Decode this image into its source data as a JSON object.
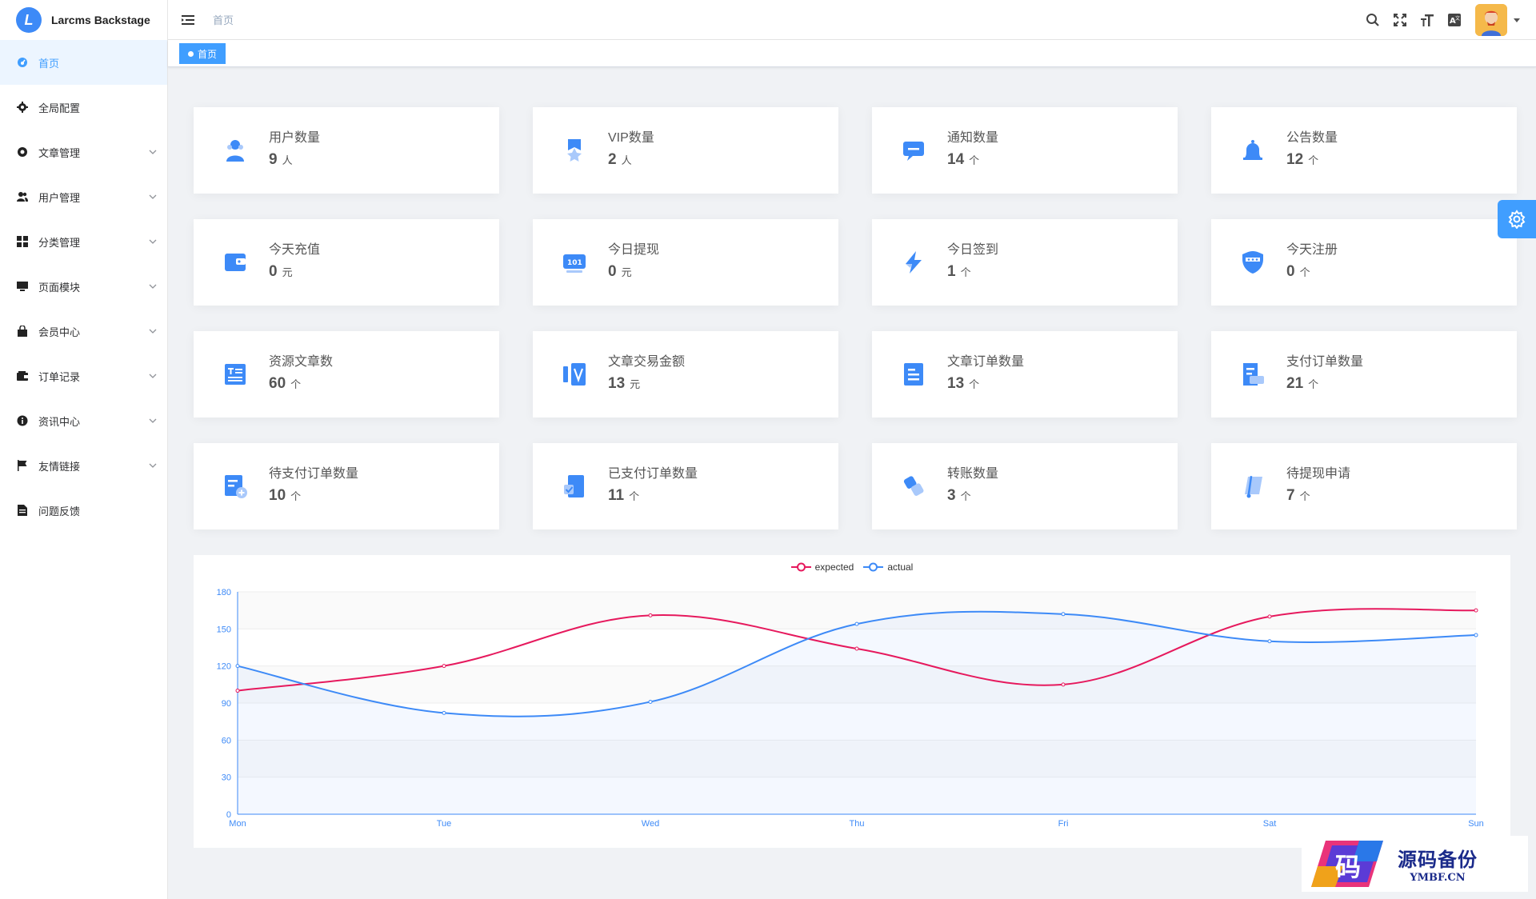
{
  "app": {
    "title": "Larcms Backstage",
    "logo_letter": "L"
  },
  "sidebar": {
    "items": [
      {
        "label": "首页",
        "icon": "dashboard-icon",
        "active": true,
        "has_children": false
      },
      {
        "label": "全局配置",
        "icon": "gear-icon",
        "active": false,
        "has_children": false
      },
      {
        "label": "文章管理",
        "icon": "lifebuoy-icon",
        "active": false,
        "has_children": true
      },
      {
        "label": "用户管理",
        "icon": "users-icon",
        "active": false,
        "has_children": true
      },
      {
        "label": "分类管理",
        "icon": "grid-icon",
        "active": false,
        "has_children": true
      },
      {
        "label": "页面模块",
        "icon": "monitor-icon",
        "active": false,
        "has_children": true
      },
      {
        "label": "会员中心",
        "icon": "shopping-bag-icon",
        "active": false,
        "has_children": true
      },
      {
        "label": "订单记录",
        "icon": "wallet-icon",
        "active": false,
        "has_children": true
      },
      {
        "label": "资讯中心",
        "icon": "info-icon",
        "active": false,
        "has_children": true
      },
      {
        "label": "友情链接",
        "icon": "flag-icon",
        "active": false,
        "has_children": true
      },
      {
        "label": "问题反馈",
        "icon": "document-icon",
        "active": false,
        "has_children": false
      }
    ]
  },
  "header": {
    "breadcrumb": "首页",
    "icons": [
      "search-icon",
      "fullscreen-icon",
      "font-size-icon",
      "translate-icon"
    ]
  },
  "tags": {
    "active_tag": "首页"
  },
  "cards": [
    {
      "label": "用户数量",
      "value": "9",
      "unit": "人",
      "icon": "user-icon"
    },
    {
      "label": "VIP数量",
      "value": "2",
      "unit": "人",
      "icon": "vip-star-icon"
    },
    {
      "label": "通知数量",
      "value": "14",
      "unit": "个",
      "icon": "message-icon"
    },
    {
      "label": "公告数量",
      "value": "12",
      "unit": "个",
      "icon": "bell-icon"
    },
    {
      "label": "今天充值",
      "value": "0",
      "unit": "元",
      "icon": "wallet-icon"
    },
    {
      "label": "今日提现",
      "value": "0",
      "unit": "元",
      "icon": "cash-icon"
    },
    {
      "label": "今日签到",
      "value": "1",
      "unit": "个",
      "icon": "lightning-icon"
    },
    {
      "label": "今天注册",
      "value": "0",
      "unit": "个",
      "icon": "shield-icon"
    },
    {
      "label": "资源文章数",
      "value": "60",
      "unit": "个",
      "icon": "article-icon"
    },
    {
      "label": "文章交易金额",
      "value": "13",
      "unit": "元",
      "icon": "trade-icon"
    },
    {
      "label": "文章订单数量",
      "value": "13",
      "unit": "个",
      "icon": "order-icon"
    },
    {
      "label": "支付订单数量",
      "value": "21",
      "unit": "个",
      "icon": "payment-icon"
    },
    {
      "label": "待支付订单数量",
      "value": "10",
      "unit": "个",
      "icon": "pending-order-icon"
    },
    {
      "label": "已支付订单数量",
      "value": "11",
      "unit": "个",
      "icon": "paid-order-icon"
    },
    {
      "label": "转账数量",
      "value": "3",
      "unit": "个",
      "icon": "transfer-icon"
    },
    {
      "label": "待提现申请",
      "value": "7",
      "unit": "个",
      "icon": "withdraw-icon"
    }
  ],
  "colors": {
    "primary": "#409eff",
    "icon_blue": "#3d8af7",
    "expected": "#e6195d",
    "actual": "#3d8af7"
  },
  "watermark": {
    "cn": "源码备份",
    "en": "YMBF.CN",
    "glyph": "码"
  },
  "chart_data": {
    "type": "line",
    "categories": [
      "Mon",
      "Tue",
      "Wed",
      "Thu",
      "Fri",
      "Sat",
      "Sun"
    ],
    "series": [
      {
        "name": "expected",
        "values": [
          100,
          120,
          161,
          134,
          105,
          160,
          165
        ]
      },
      {
        "name": "actual",
        "values": [
          120,
          82,
          91,
          154,
          162,
          140,
          145
        ]
      }
    ],
    "ylim": [
      0,
      180
    ],
    "yticks": [
      0,
      30,
      60,
      90,
      120,
      150,
      180
    ],
    "smooth": true,
    "legend": "top-center",
    "grid": true
  }
}
